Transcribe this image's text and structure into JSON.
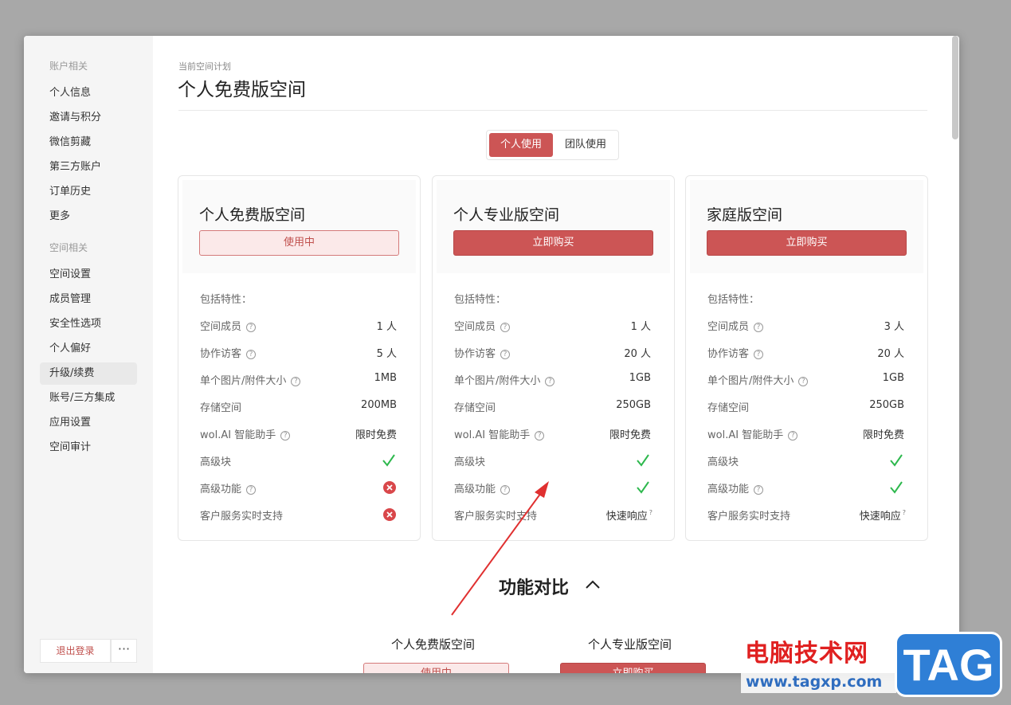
{
  "sidebar": {
    "account_section": "账户相关",
    "account_items": [
      "个人信息",
      "邀请与积分",
      "微信剪藏",
      "第三方账户",
      "订单历史",
      "更多"
    ],
    "space_section": "空间相关",
    "space_items": [
      "空间设置",
      "成员管理",
      "安全性选项",
      "个人偏好",
      "升级/续费",
      "账号/三方集成",
      "应用设置",
      "空间审计"
    ],
    "active_item": "升级/续费",
    "logout_label": "退出登录",
    "more_label": "···"
  },
  "header": {
    "breadcrumb": "当前空间计划",
    "title": "个人免费版空间"
  },
  "toggle": {
    "personal": "个人使用",
    "team": "团队使用",
    "selected": "个人使用"
  },
  "features_label": "包括特性：",
  "feature_names": [
    "空间成员",
    "协作访客",
    "单个图片/附件大小",
    "存储空间",
    "wol.AI 智能助手",
    "高级块",
    "高级功能",
    "客户服务实时支持"
  ],
  "plans": [
    {
      "title": "个人免费版空间",
      "button": "使用中",
      "values": [
        "1 人",
        "5 人",
        "1MB",
        "200MB",
        "限时免费",
        "check",
        "cross",
        "cross"
      ]
    },
    {
      "title": "个人专业版空间",
      "button": "立即购买",
      "values": [
        "1 人",
        "20 人",
        "1GB",
        "250GB",
        "限时免费",
        "check",
        "check",
        "快速响应"
      ]
    },
    {
      "title": "家庭版空间",
      "button": "立即购买",
      "values": [
        "3 人",
        "20 人",
        "1GB",
        "250GB",
        "限时免费",
        "check",
        "check",
        "快速响应"
      ]
    }
  ],
  "comparison": {
    "title": "功能对比",
    "columns": [
      {
        "title": "个人免费版空间",
        "button": "使用中"
      },
      {
        "title": "个人专业版空间",
        "button": "立即购买"
      }
    ]
  },
  "watermark": {
    "text": "电脑技术网",
    "url": "www.tagxp.com",
    "logo": "TAG"
  },
  "colors": {
    "accent": "#cc5555",
    "check": "#2db84d",
    "cross": "#d9474a",
    "arrow": "#e03030"
  }
}
